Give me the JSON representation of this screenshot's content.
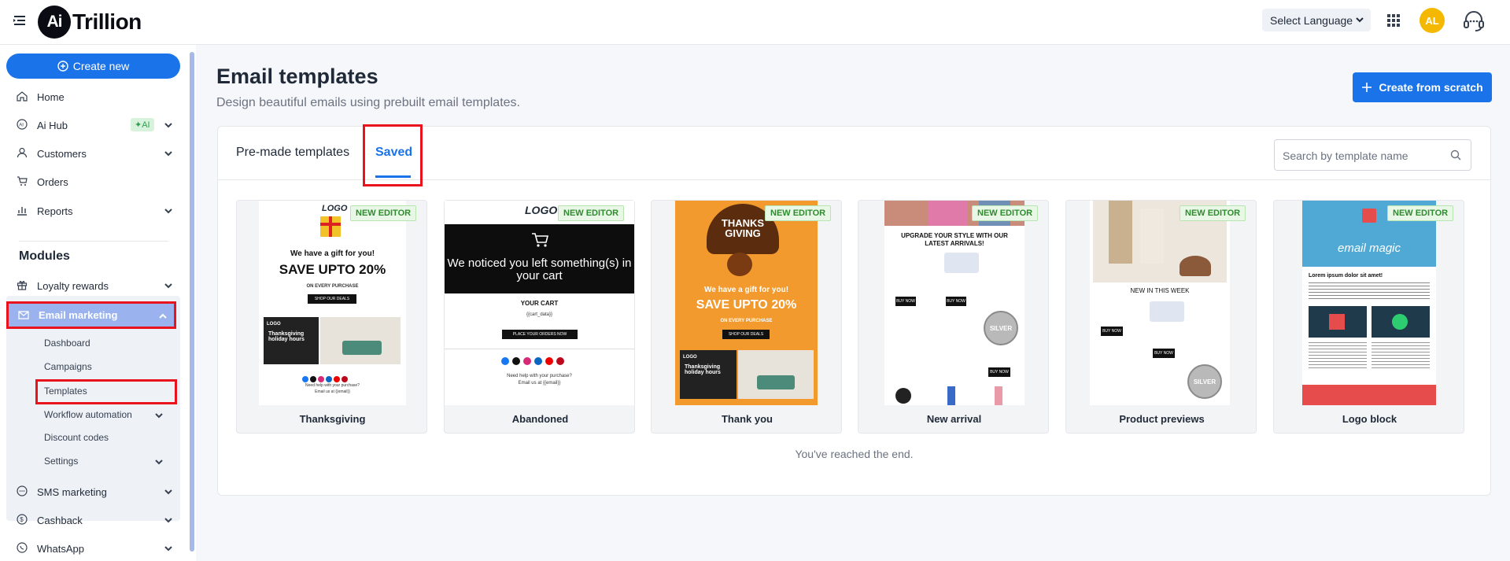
{
  "topbar": {
    "logo_badge": "Ai",
    "logo_text": "Trillion",
    "language_label": "Select Language",
    "avatar_initials": "AL"
  },
  "sidebar": {
    "create_new_label": "Create new",
    "items": [
      {
        "label": "Home",
        "icon": "home-icon"
      },
      {
        "label": "Ai Hub",
        "icon": "ai-hub-icon",
        "badge": "✦AI"
      },
      {
        "label": "Customers",
        "icon": "customers-icon"
      },
      {
        "label": "Orders",
        "icon": "cart-icon"
      },
      {
        "label": "Reports",
        "icon": "reports-icon"
      }
    ],
    "modules_label": "Modules",
    "loyalty_label": "Loyalty rewards",
    "email_marketing_label": "Email marketing",
    "email_sub": [
      "Dashboard",
      "Campaigns",
      "Templates",
      "Workflow automation",
      "Discount codes",
      "Settings"
    ],
    "sms_label": "SMS marketing",
    "cashback_label": "Cashback",
    "whatsapp_label": "WhatsApp"
  },
  "main": {
    "title": "Email templates",
    "subtitle": "Design beautiful emails using prebuilt email templates.",
    "create_scratch_label": "Create from scratch",
    "tabs": [
      "Pre-made templates",
      "Saved"
    ],
    "active_tab": "Saved",
    "search_placeholder": "Search by template name",
    "badge_label": "NEW EDITOR",
    "cards": [
      {
        "name": "Thanksgiving"
      },
      {
        "name": "Abandoned"
      },
      {
        "name": "Thank you"
      },
      {
        "name": "New arrival"
      },
      {
        "name": "Product previews"
      },
      {
        "name": "Logo block"
      }
    ],
    "end_text": "You've reached the end."
  },
  "thumbs": {
    "logo": "LOGO",
    "gift_line": "We have a gift for you!",
    "save_line": "SAVE UPTO 20%",
    "every_purchase": "ON EVERY PURCHASE",
    "shop_deals": "SHOP OUR DEALS",
    "holiday_hours": "Thanksgiving holiday hours",
    "noticed": "We noticed you left something(s) in your cart",
    "your_cart": "YOUR CART",
    "cart_data": "{{cart_data}}",
    "place_order": "PLACE YOUR ORDERS NOW",
    "need_help": "Need help with your purchase?",
    "email_us": "Email us at {{email}}",
    "happy_thanks": "THANKS GIVING",
    "upgrade": "UPGRADE YOUR STYLE WITH OUR LATEST ARRIVALS!",
    "new_week": "NEW IN THIS WEEK",
    "silver": "SILVER",
    "buy_now": "BUY NOW",
    "email_magic": "email magic",
    "lorem": "Lorem ipsum dolor sit amet!"
  },
  "colors": {
    "accent": "#1a73e8",
    "highlight_box": "#e8131c",
    "thank_you_bg": "#f29a2e",
    "logo_block_header": "#4fa9d4",
    "logo_block_footer": "#e74c4c"
  }
}
